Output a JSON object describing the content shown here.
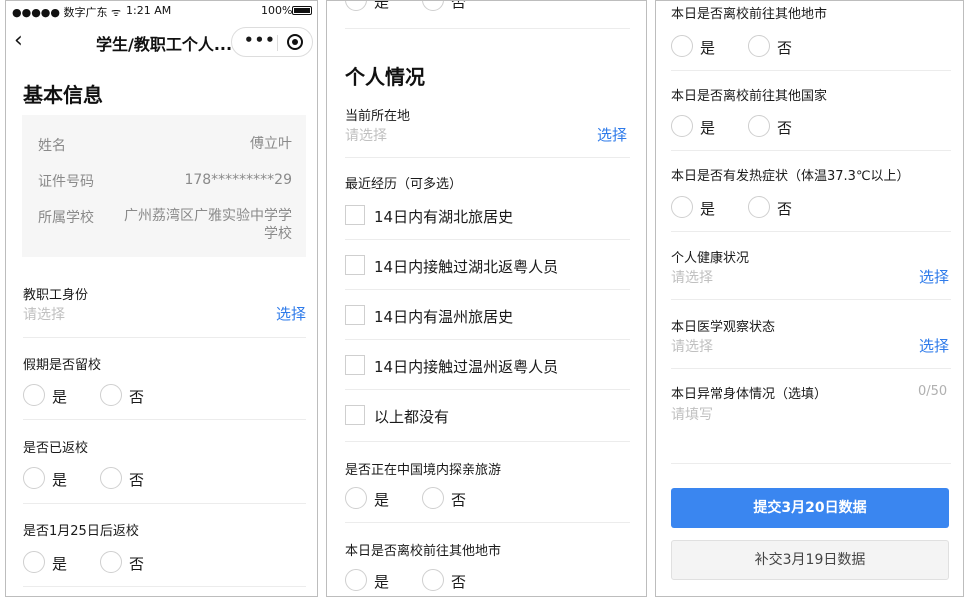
{
  "status_bar": {
    "carrier": "●●●●● 数字广东 ᯤ",
    "time": "1:21 AM",
    "battery": "100%"
  },
  "nav": {
    "title": "学生/教职工个人...",
    "more_icon": "•••"
  },
  "panel1": {
    "section_title": "基本信息",
    "info": [
      {
        "label": "姓名",
        "value": "傅立叶"
      },
      {
        "label": "证件号码",
        "value": "178*********29"
      },
      {
        "label": "所属学校",
        "value_line1": "广州荔湾区广雅实验中学学",
        "value_line2": "学校"
      }
    ],
    "identity": {
      "label": "教职工身份",
      "placeholder": "请选择",
      "action": "选择"
    },
    "questions": [
      {
        "label": "假期是否留校",
        "yes": "是",
        "no": "否"
      },
      {
        "label": "是否已返校",
        "yes": "是",
        "no": "否"
      },
      {
        "label": "是否1月25日后返校",
        "yes": "是",
        "no": "否"
      }
    ]
  },
  "panel2": {
    "top_partial": {
      "yes": "是",
      "no": "否"
    },
    "section_title": "个人情况",
    "location": {
      "label": "当前所在地",
      "placeholder": "请选择",
      "action": "选择"
    },
    "history": {
      "label": "最近经历（可多选）",
      "options": [
        "14日内有湖北旅居史",
        "14日内接触过湖北返粤人员",
        "14日内有温州旅居史",
        "14日内接触过温州返粤人员",
        "以上都没有"
      ]
    },
    "questions": [
      {
        "label": "是否正在中国境内探亲旅游",
        "yes": "是",
        "no": "否"
      },
      {
        "label": "本日是否离校前往其他地市",
        "yes": "是",
        "no": "否"
      }
    ]
  },
  "panel3": {
    "questions": [
      {
        "label": "本日是否离校前往其他地市",
        "yes": "是",
        "no": "否"
      },
      {
        "label": "本日是否离校前往其他国家",
        "yes": "是",
        "no": "否"
      },
      {
        "label": "本日是否有发热症状（体温37.3℃以上）",
        "yes": "是",
        "no": "否"
      }
    ],
    "health": {
      "label": "个人健康状况",
      "placeholder": "请选择",
      "action": "选择"
    },
    "medical": {
      "label": "本日医学观察状态",
      "placeholder": "请选择",
      "action": "选择"
    },
    "abnormal": {
      "label": "本日异常身体情况（选填）",
      "counter": "0/50",
      "placeholder": "请填写"
    },
    "submit_label": "提交3月20日数据",
    "resubmit_label": "补交3月19日数据"
  },
  "colors": {
    "accent": "#3a86f0",
    "link": "#2f7bea",
    "placeholder": "#c0c0c0"
  }
}
